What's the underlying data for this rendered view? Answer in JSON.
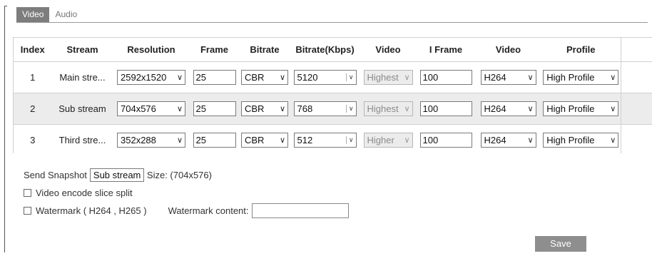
{
  "tabs": [
    {
      "label": "Video",
      "active": true
    },
    {
      "label": "Audio",
      "active": false
    }
  ],
  "table": {
    "headers": [
      "Index",
      "Stream",
      "Resolution",
      "Frame",
      "Bitrate",
      "Bitrate(Kbps)",
      "Video",
      "I Frame",
      "Video",
      "Profile"
    ],
    "rows": [
      {
        "index": "1",
        "stream": "Main stre...",
        "resolution": "2592x1520",
        "frame": "25",
        "bitrate_mode": "CBR",
        "bitrate_kbps": "5120",
        "video_quality": "Highest",
        "iframe": "100",
        "video_codec": "H264",
        "profile": "High Profile"
      },
      {
        "index": "2",
        "stream": "Sub stream",
        "resolution": "704x576",
        "frame": "25",
        "bitrate_mode": "CBR",
        "bitrate_kbps": "768",
        "video_quality": "Highest",
        "iframe": "100",
        "video_codec": "H264",
        "profile": "High Profile"
      },
      {
        "index": "3",
        "stream": "Third stre...",
        "resolution": "352x288",
        "frame": "25",
        "bitrate_mode": "CBR",
        "bitrate_kbps": "512",
        "video_quality": "Higher",
        "iframe": "100",
        "video_codec": "H264",
        "profile": "High Profile"
      }
    ]
  },
  "snapshot": {
    "label": "Send Snapshot",
    "value": "Sub stream",
    "size_text": "Size: (704x576)"
  },
  "slice_split": {
    "label": "Video encode slice split",
    "checked": false
  },
  "watermark": {
    "label": "Watermark ( H264 , H265 )",
    "checked": false,
    "content_label": "Watermark content:",
    "content_value": ""
  },
  "save_label": "Save",
  "colors": {
    "tab_active_bg": "#7d7d7d",
    "row_alt_bg": "#ececec",
    "save_bg": "#8e8e8e"
  }
}
